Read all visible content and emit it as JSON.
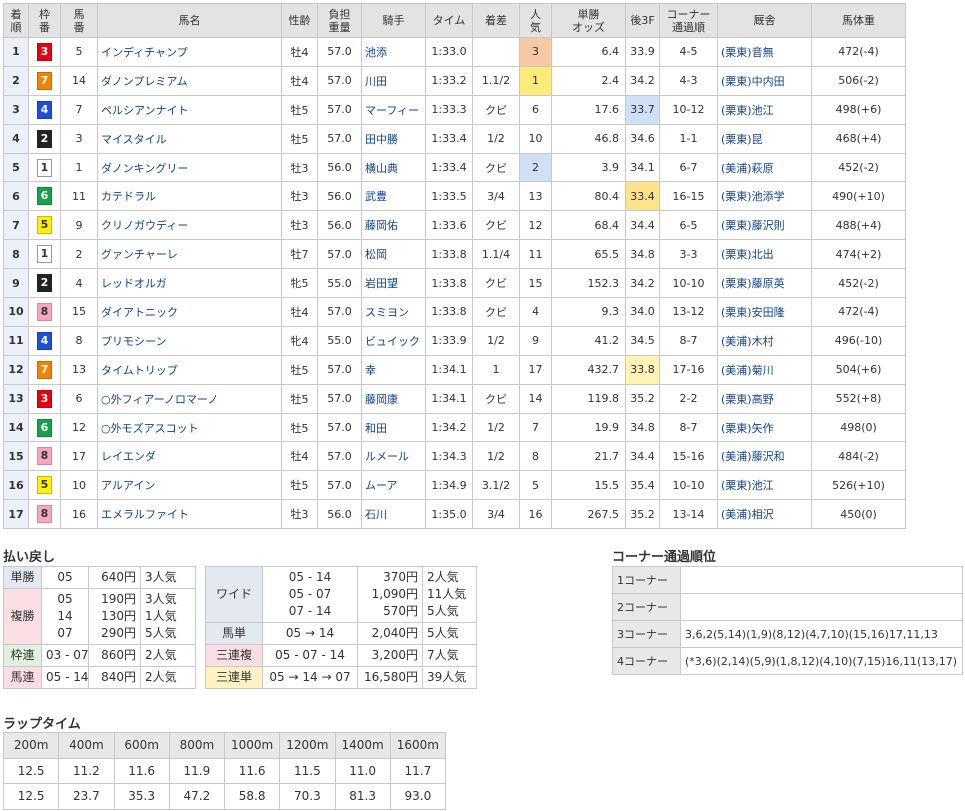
{
  "results": {
    "headers": [
      {
        "l1": "着",
        "l2": "順"
      },
      {
        "l1": "枠",
        "l2": "番"
      },
      {
        "l1": "馬",
        "l2": "番"
      },
      {
        "l1": "馬名",
        "l2": ""
      },
      {
        "l1": "性齢",
        "l2": ""
      },
      {
        "l1": "負担",
        "l2": "重量"
      },
      {
        "l1": "騎手",
        "l2": ""
      },
      {
        "l1": "タイム",
        "l2": ""
      },
      {
        "l1": "着差",
        "l2": ""
      },
      {
        "l1": "人",
        "l2": "気"
      },
      {
        "l1": "単勝",
        "l2": "オッズ"
      },
      {
        "l1": "後3F",
        "l2": ""
      },
      {
        "l1": "コーナー",
        "l2": "通過順"
      },
      {
        "l1": "厩舎",
        "l2": ""
      },
      {
        "l1": "馬体重",
        "l2": ""
      }
    ],
    "rows": [
      {
        "rank": "1",
        "waku": "3",
        "umaban": "5",
        "name": "インディチャンプ",
        "sexage": "牡4",
        "weight": "57.0",
        "jockey": "池添",
        "time": "1:33.0",
        "margin": "",
        "pop": "3",
        "odds": "6.4",
        "last3f": "33.9",
        "corner": "4-5",
        "stable": "(栗東)音無",
        "body": "472(-4)"
      },
      {
        "rank": "2",
        "waku": "7",
        "umaban": "14",
        "name": "ダノンプレミアム",
        "sexage": "牡4",
        "weight": "57.0",
        "jockey": "川田",
        "time": "1:33.2",
        "margin": "1.1/2",
        "pop": "1",
        "odds": "2.4",
        "last3f": "34.2",
        "corner": "4-3",
        "stable": "(栗東)中内田",
        "body": "506(-2)"
      },
      {
        "rank": "3",
        "waku": "4",
        "umaban": "7",
        "name": "ペルシアンナイト",
        "sexage": "牡5",
        "weight": "57.0",
        "jockey": "マーフィー",
        "time": "1:33.3",
        "margin": "クビ",
        "pop": "6",
        "odds": "17.6",
        "last3f": "33.7",
        "corner": "10-12",
        "stable": "(栗東)池江",
        "body": "498(+6)"
      },
      {
        "rank": "4",
        "waku": "2",
        "umaban": "3",
        "name": "マイスタイル",
        "sexage": "牡5",
        "weight": "57.0",
        "jockey": "田中勝",
        "time": "1:33.4",
        "margin": "1/2",
        "pop": "10",
        "odds": "46.8",
        "last3f": "34.6",
        "corner": "1-1",
        "stable": "(栗東)昆",
        "body": "468(+4)"
      },
      {
        "rank": "5",
        "waku": "1",
        "umaban": "1",
        "name": "ダノンキングリー",
        "sexage": "牡3",
        "weight": "56.0",
        "jockey": "横山典",
        "time": "1:33.4",
        "margin": "クビ",
        "pop": "2",
        "odds": "3.9",
        "last3f": "34.1",
        "corner": "6-7",
        "stable": "(美浦)萩原",
        "body": "452(-2)"
      },
      {
        "rank": "6",
        "waku": "6",
        "umaban": "11",
        "name": "カテドラル",
        "sexage": "牡3",
        "weight": "56.0",
        "jockey": "武豊",
        "time": "1:33.5",
        "margin": "3/4",
        "pop": "13",
        "odds": "80.4",
        "last3f": "33.4",
        "corner": "16-15",
        "stable": "(栗東)池添学",
        "body": "490(+10)"
      },
      {
        "rank": "7",
        "waku": "5",
        "umaban": "9",
        "name": "クリノガウディー",
        "sexage": "牡3",
        "weight": "56.0",
        "jockey": "藤岡佑",
        "time": "1:33.6",
        "margin": "クビ",
        "pop": "12",
        "odds": "68.4",
        "last3f": "34.4",
        "corner": "6-5",
        "stable": "(栗東)藤沢則",
        "body": "488(+4)"
      },
      {
        "rank": "8",
        "waku": "1",
        "umaban": "2",
        "name": "グァンチャーレ",
        "sexage": "牡7",
        "weight": "57.0",
        "jockey": "松岡",
        "time": "1:33.8",
        "margin": "1.1/4",
        "pop": "11",
        "odds": "65.5",
        "last3f": "34.8",
        "corner": "3-3",
        "stable": "(栗東)北出",
        "body": "474(+2)"
      },
      {
        "rank": "9",
        "waku": "2",
        "umaban": "4",
        "name": "レッドオルガ",
        "sexage": "牝5",
        "weight": "55.0",
        "jockey": "岩田望",
        "time": "1:33.8",
        "margin": "クビ",
        "pop": "15",
        "odds": "152.3",
        "last3f": "34.2",
        "corner": "10-10",
        "stable": "(栗東)藤原英",
        "body": "452(-2)"
      },
      {
        "rank": "10",
        "waku": "8",
        "umaban": "15",
        "name": "ダイアトニック",
        "sexage": "牡4",
        "weight": "57.0",
        "jockey": "スミヨン",
        "time": "1:33.8",
        "margin": "クビ",
        "pop": "4",
        "odds": "9.3",
        "last3f": "34.0",
        "corner": "13-12",
        "stable": "(栗東)安田隆",
        "body": "472(-4)"
      },
      {
        "rank": "11",
        "waku": "4",
        "umaban": "8",
        "name": "プリモシーン",
        "sexage": "牝4",
        "weight": "55.0",
        "jockey": "ビュイック",
        "time": "1:33.9",
        "margin": "1/2",
        "pop": "9",
        "odds": "41.2",
        "last3f": "34.5",
        "corner": "8-7",
        "stable": "(美浦)木村",
        "body": "496(-10)"
      },
      {
        "rank": "12",
        "waku": "7",
        "umaban": "13",
        "name": "タイムトリップ",
        "sexage": "牡5",
        "weight": "57.0",
        "jockey": "幸",
        "time": "1:34.1",
        "margin": "1",
        "pop": "17",
        "odds": "432.7",
        "last3f": "33.8",
        "corner": "17-16",
        "stable": "(美浦)菊川",
        "body": "504(+6)"
      },
      {
        "rank": "13",
        "waku": "3",
        "umaban": "6",
        "name": "○外フィアーノロマーノ",
        "sexage": "牡5",
        "weight": "57.0",
        "jockey": "藤岡康",
        "time": "1:34.1",
        "margin": "クビ",
        "pop": "14",
        "odds": "119.8",
        "last3f": "35.2",
        "corner": "2-2",
        "stable": "(栗東)高野",
        "body": "552(+8)"
      },
      {
        "rank": "14",
        "waku": "6",
        "umaban": "12",
        "name": "○外モズアスコット",
        "sexage": "牡5",
        "weight": "57.0",
        "jockey": "和田",
        "time": "1:34.2",
        "margin": "1/2",
        "pop": "7",
        "odds": "19.9",
        "last3f": "34.8",
        "corner": "8-7",
        "stable": "(栗東)矢作",
        "body": "498(0)"
      },
      {
        "rank": "15",
        "waku": "8",
        "umaban": "17",
        "name": "レイエンダ",
        "sexage": "牡4",
        "weight": "57.0",
        "jockey": "ルメール",
        "time": "1:34.3",
        "margin": "1/2",
        "pop": "8",
        "odds": "21.7",
        "last3f": "34.4",
        "corner": "15-16",
        "stable": "(美浦)藤沢和",
        "body": "484(-2)"
      },
      {
        "rank": "16",
        "waku": "5",
        "umaban": "10",
        "name": "アルアイン",
        "sexage": "牡5",
        "weight": "57.0",
        "jockey": "ムーア",
        "time": "1:34.9",
        "margin": "3.1/2",
        "pop": "5",
        "odds": "15.5",
        "last3f": "35.4",
        "corner": "10-10",
        "stable": "(栗東)池江",
        "body": "526(+10)"
      },
      {
        "rank": "17",
        "waku": "8",
        "umaban": "16",
        "name": "エメラルファイト",
        "sexage": "牡3",
        "weight": "56.0",
        "jockey": "石川",
        "time": "1:35.0",
        "margin": "3/4",
        "pop": "16",
        "odds": "267.5",
        "last3f": "35.2",
        "corner": "13-14",
        "stable": "(美浦)相沢",
        "body": "450(0)"
      }
    ]
  },
  "payout": {
    "title": "払い戻し",
    "tansho": {
      "label": "単勝",
      "num": "05",
      "yen": "640円",
      "ninki": "3人気"
    },
    "fukusho": {
      "label": "複勝",
      "nums": [
        "05",
        "14",
        "07"
      ],
      "yens": [
        "190円",
        "130円",
        "290円"
      ],
      "ninkis": [
        "3人気",
        "1人気",
        "5人気"
      ]
    },
    "wakuren": {
      "label": "枠連",
      "num": "03 - 07",
      "yen": "860円",
      "ninki": "2人気"
    },
    "umaren": {
      "label": "馬連",
      "num": "05 - 14",
      "yen": "840円",
      "ninki": "2人気"
    },
    "wide": {
      "label": "ワイド",
      "nums": [
        "05 - 14",
        "05 - 07",
        "07 - 14"
      ],
      "yens": [
        "370円",
        "1,090円",
        "570円"
      ],
      "ninkis": [
        "2人気",
        "11人気",
        "5人気"
      ]
    },
    "umatan": {
      "label": "馬単",
      "num": "05 → 14",
      "yen": "2,040円",
      "ninki": "5人気"
    },
    "sanrenpuku": {
      "label": "三連複",
      "num": "05 - 07 - 14",
      "yen": "3,200円",
      "ninki": "7人気"
    },
    "sanrentan": {
      "label": "三連単",
      "num": "05 → 14 → 07",
      "yen": "16,580円",
      "ninki": "39人気"
    }
  },
  "corner": {
    "title": "コーナー通過順位",
    "rows": [
      {
        "label": "1コーナー",
        "order": ""
      },
      {
        "label": "2コーナー",
        "order": ""
      },
      {
        "label": "3コーナー",
        "order": "3,6,2(5,14)(1,9)(8,12)(4,7,10)(15,16)17,11,13"
      },
      {
        "label": "4コーナー",
        "order": "(*3,6)(2,14)(5,9)(1,8,12)(4,10)(7,15)16,11(13,17)"
      }
    ]
  },
  "laps": {
    "title": "ラップタイム",
    "distances": [
      "200m",
      "400m",
      "600m",
      "800m",
      "1000m",
      "1200m",
      "1400m",
      "1600m"
    ],
    "laps": [
      "12.5",
      "11.2",
      "11.6",
      "11.9",
      "11.6",
      "11.5",
      "11.0",
      "11.7"
    ],
    "cumulative": [
      "12.5",
      "23.7",
      "35.3",
      "47.2",
      "58.8",
      "70.3",
      "81.3",
      "93.0"
    ]
  }
}
